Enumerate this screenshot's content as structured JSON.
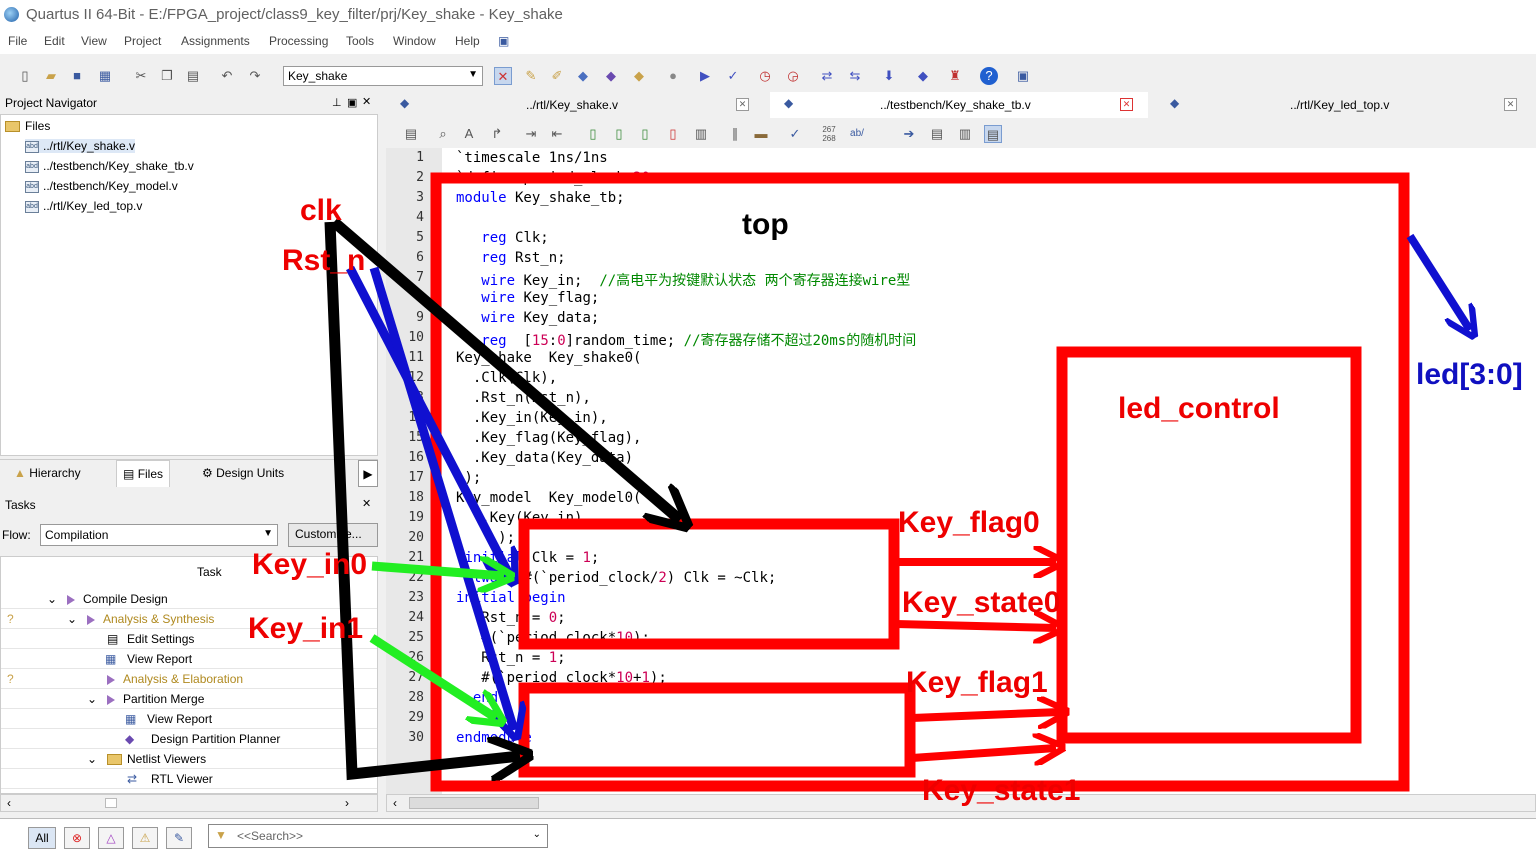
{
  "window": {
    "title": "Quartus II 64-Bit - E:/FPGA_project/class9_key_filter/prj/Key_shake - Key_shake"
  },
  "menu": [
    "File",
    "Edit",
    "View",
    "Project",
    "Assignments",
    "Processing",
    "Tools",
    "Window",
    "Help"
  ],
  "toolbar": {
    "project_select": "Key_shake"
  },
  "navigator": {
    "title": "Project Navigator",
    "root": "Files",
    "files": [
      "../rtl/Key_shake.v",
      "../testbench/Key_shake_tb.v",
      "../testbench/Key_model.v",
      "../rtl/Key_led_top.v"
    ],
    "tabs": [
      "Hierarchy",
      "Files",
      "Design Units"
    ]
  },
  "tasks": {
    "title": "Tasks",
    "flow_label": "Flow:",
    "flow_value": "Compilation",
    "customize_label": "Customize...",
    "column_header": "Task",
    "rows": [
      {
        "label": "Compile Design",
        "status": ""
      },
      {
        "label": "Analysis & Synthesis",
        "status": "?"
      },
      {
        "label": "Edit Settings",
        "status": ""
      },
      {
        "label": "View Report",
        "status": ""
      },
      {
        "label": "Analysis & Elaboration",
        "status": "?"
      },
      {
        "label": "Partition Merge",
        "status": ""
      },
      {
        "label": "View Report",
        "status": ""
      },
      {
        "label": "Design Partition Planner",
        "status": ""
      },
      {
        "label": "Netlist Viewers",
        "status": ""
      },
      {
        "label": "RTL Viewer",
        "status": ""
      }
    ]
  },
  "editor": {
    "tabs": [
      "../rtl/Key_shake.v",
      "../testbench/Key_shake_tb.v",
      "../rtl/Key_led_top.v"
    ],
    "line_numbers": [
      "1",
      "2",
      "3",
      "4",
      "5",
      "6",
      "7",
      "8",
      "9",
      "10",
      "11",
      "12",
      "13",
      "14",
      "15",
      "16",
      "17",
      "18",
      "19",
      "20",
      "21",
      "22",
      "23",
      "24",
      "25",
      "26",
      "27",
      "28",
      "29",
      "30"
    ],
    "lines": [
      "`timescale 1ns/1ns",
      "`define period_clock 20",
      "module Key_shake_tb;",
      "",
      "   reg Clk;",
      "   reg Rst_n;",
      "   wire Key_in;  //高电平为按键默认状态 两个寄存器连接wire型",
      "   wire Key_flag;",
      "   wire Key_data;",
      "   reg  [15:0]random_time; //寄存器存储不超过20ms的随机时间",
      "Key_shake  Key_shake0(",
      "  .Clk(Clk),",
      "  .Rst_n(Rst_n),",
      "  .Key_in(Key_in),",
      "  .Key_flag(Key_flag),",
      "  .Key_data(Key_data)",
      " );",
      "Key_model  Key_model0(",
      "   .Key(Key_in)",
      "     );",
      " initial Clk = 1;",
      " always #(`period_clock/2) Clk = ~Clk;",
      "initial begin",
      "   Rst_n = 0;",
      "   #(`period_clock*10);",
      "   Rst_n = 1;",
      "   #(`period_clock*10+1);",
      "  end",
      "",
      "endmodule"
    ]
  },
  "messages": {
    "all_label": "All",
    "search_placeholder": "<<Search>>"
  },
  "annotations": {
    "clk": "clk",
    "rst": "Rst_n",
    "top": "top",
    "led": "led[3:0]",
    "led_control": "led_control",
    "key_in0": "Key_in0",
    "key_in1": "Key_in1",
    "key_flag0": "Key_flag0",
    "key_state0": "Key_state0",
    "key_flag1": "Key_flag1",
    "key_state1": "Key_state1"
  },
  "colors": {
    "annotation_red": "#ff0000",
    "annotation_blue": "#1010d0",
    "annotation_green": "#22ee22",
    "annotation_black": "#000000"
  }
}
